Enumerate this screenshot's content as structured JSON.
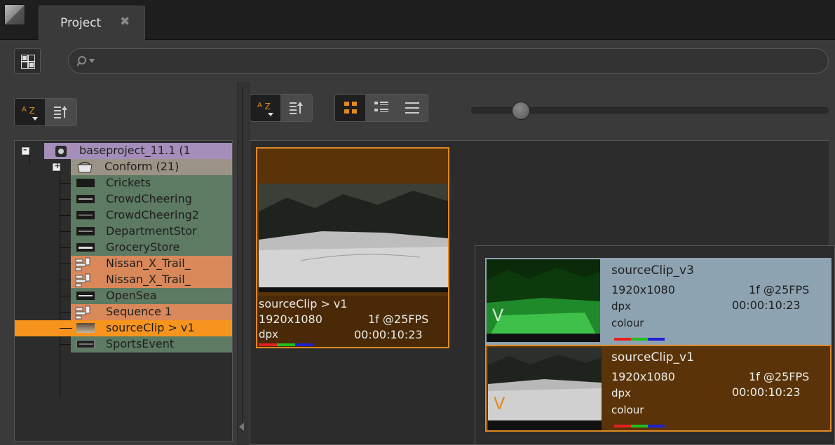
{
  "tabs": [
    {
      "label": "Project",
      "close": "✖"
    }
  ],
  "colors": {
    "accent": "#e08a20",
    "bin": "#a58fba",
    "conform": "#9b9385",
    "clip_green": "#5d7a62",
    "sequence": "#d9885a",
    "selected": "#f7941d",
    "card_bg": "#5a3408",
    "version_selected_bg": "#5a3408",
    "version_normal_bg": "#8ea3b1"
  },
  "search": {
    "placeholder": ""
  },
  "tree": {
    "root": {
      "label": "baseproject_11.1 (1",
      "icon": "project-icon"
    },
    "items": [
      {
        "label": "Conform (21)",
        "icon": "bin-icon",
        "type": "bin"
      },
      {
        "label": "Crickets",
        "icon": "clip-icon",
        "type": "clip"
      },
      {
        "label": "CrowdCheering",
        "icon": "clip-icon",
        "type": "clip"
      },
      {
        "label": "CrowdCheering2",
        "icon": "clip-icon",
        "type": "clip"
      },
      {
        "label": "DepartmentStor",
        "icon": "clip-icon",
        "type": "clip"
      },
      {
        "label": "GroceryStore",
        "icon": "clip-icon",
        "type": "clip"
      },
      {
        "label": "Nissan_X_Trail_",
        "icon": "sequence-icon",
        "type": "sequence"
      },
      {
        "label": "Nissan_X_Trail_",
        "icon": "sequence-icon",
        "type": "sequence"
      },
      {
        "label": "OpenSea",
        "icon": "clip-icon",
        "type": "clip"
      },
      {
        "label": "Sequence 1",
        "icon": "sequence-icon",
        "type": "sequence"
      },
      {
        "label": "sourceClip > v1",
        "icon": "clip-thumbnail-icon",
        "type": "selected"
      },
      {
        "label": "SportsEvent",
        "icon": "clip-icon",
        "type": "clip"
      }
    ]
  },
  "sort_buttons": {
    "az_label": "A",
    "z_label": "Z"
  },
  "zoom_level": 0.14,
  "card": {
    "title": "sourceClip > v1",
    "resolution": "1920x1080",
    "frames": "1f @25FPS",
    "format": "dpx",
    "duration": "00:00:10:23"
  },
  "versions": [
    {
      "name": "sourceClip_v3",
      "resolution": "1920x1080",
      "frames": "1f @25FPS",
      "format": "dpx",
      "duration": "00:00:10:23",
      "colour": "colour",
      "marker": "V",
      "selected": false
    },
    {
      "name": "sourceClip_v1",
      "resolution": "1920x1080",
      "frames": "1f @25FPS",
      "format": "dpx",
      "duration": "00:00:10:23",
      "colour": "colour",
      "marker": "V",
      "selected": true
    }
  ]
}
